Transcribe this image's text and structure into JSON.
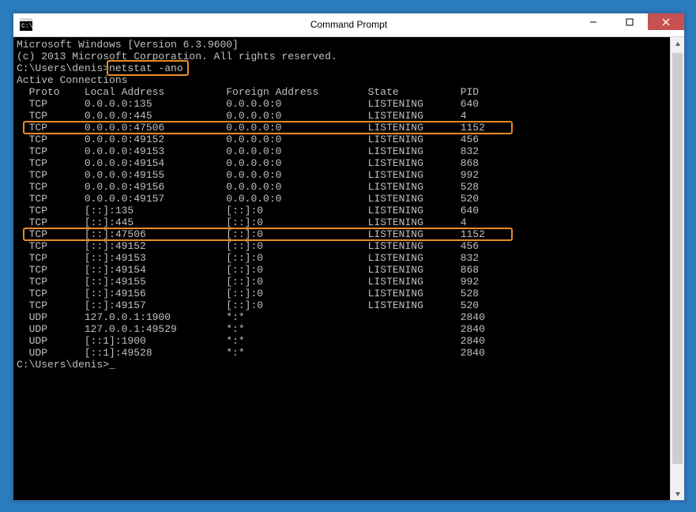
{
  "window": {
    "title": "Command Prompt"
  },
  "terminal": {
    "banner1": "Microsoft Windows [Version 6.3.9600]",
    "banner2": "(c) 2013 Microsoft Corporation. All rights reserved.",
    "prompt_path": "C:\\Users\\denis>",
    "command": "netstat -ano",
    "section_header": "Active Connections",
    "columns": {
      "proto": "Proto",
      "local": "Local Address",
      "foreign": "Foreign Address",
      "state": "State",
      "pid": "PID"
    },
    "rows": [
      {
        "proto": "TCP",
        "local": "0.0.0.0:135",
        "foreign": "0.0.0.0:0",
        "state": "LISTENING",
        "pid": "640",
        "hl": false
      },
      {
        "proto": "TCP",
        "local": "0.0.0.0:445",
        "foreign": "0.0.0.0:0",
        "state": "LISTENING",
        "pid": "4",
        "hl": false
      },
      {
        "proto": "TCP",
        "local": "0.0.0.0:47506",
        "foreign": "0.0.0.0:0",
        "state": "LISTENING",
        "pid": "1152",
        "hl": true
      },
      {
        "proto": "TCP",
        "local": "0.0.0.0:49152",
        "foreign": "0.0.0.0:0",
        "state": "LISTENING",
        "pid": "456",
        "hl": false
      },
      {
        "proto": "TCP",
        "local": "0.0.0.0:49153",
        "foreign": "0.0.0.0:0",
        "state": "LISTENING",
        "pid": "832",
        "hl": false
      },
      {
        "proto": "TCP",
        "local": "0.0.0.0:49154",
        "foreign": "0.0.0.0:0",
        "state": "LISTENING",
        "pid": "868",
        "hl": false
      },
      {
        "proto": "TCP",
        "local": "0.0.0.0:49155",
        "foreign": "0.0.0.0:0",
        "state": "LISTENING",
        "pid": "992",
        "hl": false
      },
      {
        "proto": "TCP",
        "local": "0.0.0.0:49156",
        "foreign": "0.0.0.0:0",
        "state": "LISTENING",
        "pid": "528",
        "hl": false
      },
      {
        "proto": "TCP",
        "local": "0.0.0.0:49157",
        "foreign": "0.0.0.0:0",
        "state": "LISTENING",
        "pid": "520",
        "hl": false
      },
      {
        "proto": "TCP",
        "local": "[::]:135",
        "foreign": "[::]:0",
        "state": "LISTENING",
        "pid": "640",
        "hl": false
      },
      {
        "proto": "TCP",
        "local": "[::]:445",
        "foreign": "[::]:0",
        "state": "LISTENING",
        "pid": "4",
        "hl": false
      },
      {
        "proto": "TCP",
        "local": "[::]:47506",
        "foreign": "[::]:0",
        "state": "LISTENING",
        "pid": "1152",
        "hl": true
      },
      {
        "proto": "TCP",
        "local": "[::]:49152",
        "foreign": "[::]:0",
        "state": "LISTENING",
        "pid": "456",
        "hl": false
      },
      {
        "proto": "TCP",
        "local": "[::]:49153",
        "foreign": "[::]:0",
        "state": "LISTENING",
        "pid": "832",
        "hl": false
      },
      {
        "proto": "TCP",
        "local": "[::]:49154",
        "foreign": "[::]:0",
        "state": "LISTENING",
        "pid": "868",
        "hl": false
      },
      {
        "proto": "TCP",
        "local": "[::]:49155",
        "foreign": "[::]:0",
        "state": "LISTENING",
        "pid": "992",
        "hl": false
      },
      {
        "proto": "TCP",
        "local": "[::]:49156",
        "foreign": "[::]:0",
        "state": "LISTENING",
        "pid": "528",
        "hl": false
      },
      {
        "proto": "TCP",
        "local": "[::]:49157",
        "foreign": "[::]:0",
        "state": "LISTENING",
        "pid": "520",
        "hl": false
      },
      {
        "proto": "UDP",
        "local": "127.0.0.1:1900",
        "foreign": "*:*",
        "state": "",
        "pid": "2840",
        "hl": false
      },
      {
        "proto": "UDP",
        "local": "127.0.0.1:49529",
        "foreign": "*:*",
        "state": "",
        "pid": "2840",
        "hl": false
      },
      {
        "proto": "UDP",
        "local": "[::1]:1900",
        "foreign": "*:*",
        "state": "",
        "pid": "2840",
        "hl": false
      },
      {
        "proto": "UDP",
        "local": "[::1]:49528",
        "foreign": "*:*",
        "state": "",
        "pid": "2840",
        "hl": false
      }
    ],
    "prompt_end": "C:\\Users\\denis>"
  }
}
